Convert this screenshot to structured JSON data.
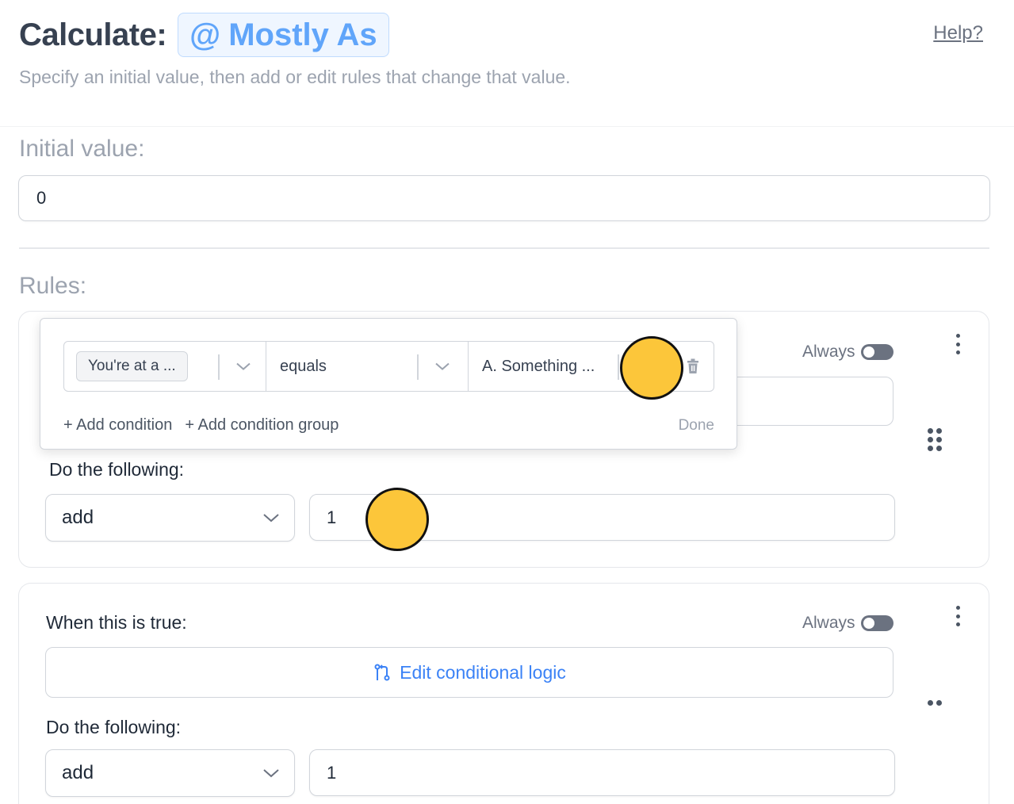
{
  "header": {
    "calc_label": "Calculate:",
    "variable_at": "@",
    "variable_name": "Mostly As",
    "help": "Help?",
    "subtitle": "Specify an initial value, then add or edit rules that change that value."
  },
  "initial": {
    "label": "Initial value:",
    "value": "0"
  },
  "rules_label": "Rules:",
  "rules": [
    {
      "always_label": "Always",
      "always_on": false,
      "do_label": "Do the following:",
      "operation": "add",
      "amount": "1",
      "popover": {
        "question": "You're at a ...",
        "operator": "equals",
        "answer": "A. Something ...",
        "add_condition": "+ Add condition",
        "add_group": "+ Add condition group",
        "done": "Done"
      }
    },
    {
      "when_label": "When this is true:",
      "always_label": "Always",
      "always_on": false,
      "edit_logic": "Edit conditional logic",
      "do_label": "Do the following:",
      "operation": "add",
      "amount": "1"
    }
  ],
  "colors": {
    "accent": "#3b82f6",
    "marker": "#fcc63a"
  }
}
